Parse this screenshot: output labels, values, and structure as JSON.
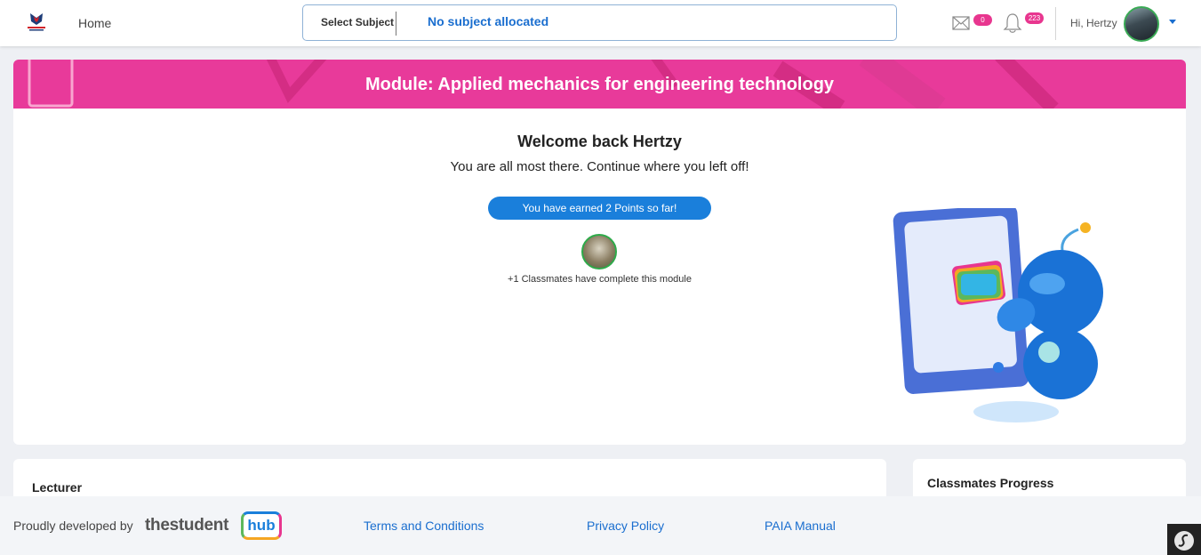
{
  "header": {
    "home_label": "Home",
    "subject_label": "Select Subject",
    "subject_value": "No subject allocated",
    "mail_count": "0",
    "notification_count": "223",
    "greeting": "Hi, Hertzy"
  },
  "banner": {
    "title": "Module: Applied mechanics for engineering technology"
  },
  "welcome": {
    "title": "Welcome back Hertzy",
    "subtitle": "You are all most there. Continue where you left off!",
    "points_text": "You have earned 2 Points so far!",
    "classmates_text": "+1 Classmates have complete this module"
  },
  "cards": {
    "lecturer_title": "Lecturer",
    "classmates_progress_title": "Classmates Progress"
  },
  "footer": {
    "developed_by": "Proudly developed by",
    "brand_text": "thestudent",
    "brand_box_text": "hub",
    "terms": "Terms and Conditions",
    "privacy": "Privacy Policy",
    "paia": "PAIA Manual"
  },
  "colors": {
    "accent_blue": "#1a7fdb",
    "banner_pink": "#e83a9a",
    "badge_pink": "#e8368f"
  }
}
